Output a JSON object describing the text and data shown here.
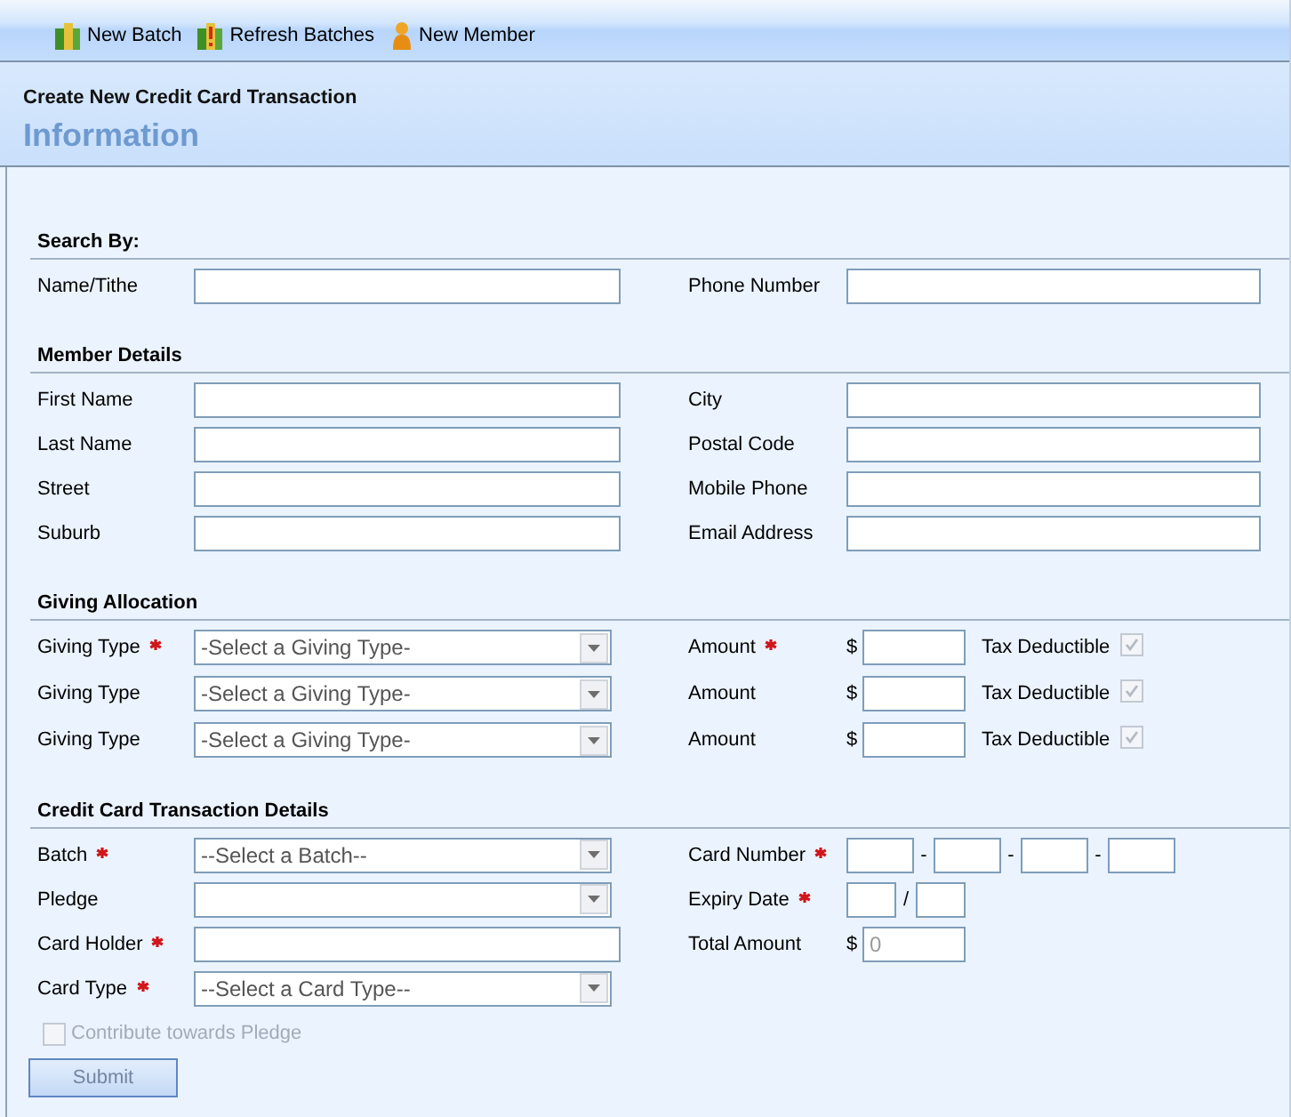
{
  "toolbar": {
    "items": [
      {
        "kind": "batch",
        "label": "New Batch"
      },
      {
        "kind": "refresh",
        "label": "Refresh Batches"
      },
      {
        "kind": "member",
        "label": "New Member"
      }
    ]
  },
  "header": {
    "subtitle": "Create New Credit Card Transaction",
    "title": "Information"
  },
  "sections": [
    {
      "heading": "Search By:",
      "left": [
        {
          "kind": "text",
          "label": "Name/Tithe",
          "required": false
        }
      ],
      "right": [
        {
          "kind": "text",
          "label": "Phone Number",
          "required": false
        }
      ]
    },
    {
      "heading": "Member Details",
      "left": [
        {
          "kind": "text",
          "label": "First Name",
          "required": false
        },
        {
          "kind": "text",
          "label": "Last Name",
          "required": false
        },
        {
          "kind": "text",
          "label": "Street",
          "required": false
        },
        {
          "kind": "text",
          "label": "Suburb",
          "required": false
        }
      ],
      "right": [
        {
          "kind": "text",
          "label": "City",
          "required": false
        },
        {
          "kind": "text",
          "label": "Postal Code",
          "required": false
        },
        {
          "kind": "text",
          "label": "Mobile Phone",
          "required": false
        },
        {
          "kind": "text",
          "label": "Email Address",
          "required": false
        }
      ]
    },
    {
      "heading": "Giving Allocation",
      "left": [
        {
          "kind": "select",
          "label": "Giving Type",
          "required": true,
          "value": "-Select a Giving Type-"
        },
        {
          "kind": "select",
          "label": "Giving Type",
          "required": false,
          "value": "-Select a Giving Type-"
        },
        {
          "kind": "select",
          "label": "Giving Type",
          "required": false,
          "value": "-Select a Giving Type-"
        }
      ],
      "right": [
        {
          "kind": "amount",
          "label": "Amount",
          "required": true,
          "currency": "$",
          "tax_deductible": {
            "label": "Tax Deductible",
            "checked": true,
            "disabled": true
          }
        },
        {
          "kind": "amount",
          "label": "Amount",
          "required": false,
          "currency": "$",
          "tax_deductible": {
            "label": "Tax Deductible",
            "checked": true,
            "disabled": true
          }
        },
        {
          "kind": "amount",
          "label": "Amount",
          "required": false,
          "currency": "$",
          "tax_deductible": {
            "label": "Tax Deductible",
            "checked": true,
            "disabled": true
          }
        }
      ]
    },
    {
      "heading": "Credit Card Transaction Details",
      "left": [
        {
          "kind": "select",
          "label": "Batch",
          "required": true,
          "value": "--Select a Batch--"
        },
        {
          "kind": "select",
          "label": "Pledge",
          "required": false
        },
        {
          "kind": "text",
          "label": "Card Holder",
          "required": true
        },
        {
          "kind": "select",
          "label": "Card Type",
          "required": true,
          "value": "--Select a Card Type--"
        }
      ],
      "right": [
        {
          "kind": "split",
          "label": "Card Number",
          "required": true,
          "separators": [
            "-",
            "-",
            "-"
          ]
        },
        {
          "kind": "split",
          "label": "Expiry Date",
          "required": true,
          "separators": [
            "/"
          ]
        },
        {
          "kind": "amount",
          "label": "Total Amount",
          "required": false,
          "currency": "$",
          "placeholder": "0"
        }
      ]
    }
  ],
  "pledge_option": {
    "label": "Contribute towards Pledge",
    "checked": false,
    "disabled": true
  },
  "submit": {
    "label": "Submit",
    "disabled": true
  }
}
